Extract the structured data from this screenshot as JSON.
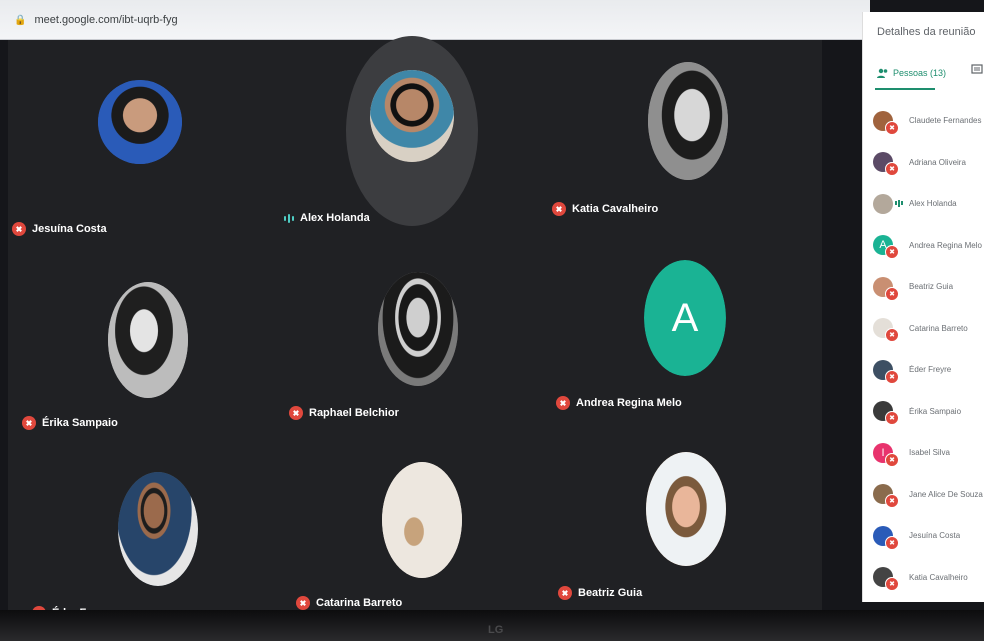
{
  "browser": {
    "url": "meet.google.com/ibt-uqrb-fyg"
  },
  "colors": {
    "mic_off": "#e0483d",
    "accent": "#1e8e6e",
    "stage_bg": "#202124",
    "andrea_avatar": "#1ab394",
    "isabel_avatar": "#e8336d"
  },
  "grid": {
    "tiles": [
      {
        "name": "Jesuína Costa",
        "state": "muted",
        "photo": "#2a5bb8"
      },
      {
        "name": "Alex Holanda",
        "state": "speaking",
        "photo": "#c9c0b4"
      },
      {
        "name": "Katia Cavalheiro",
        "state": "muted",
        "photo": "#9a9a9a"
      },
      {
        "name": "Érika Sampaio",
        "state": "muted",
        "photo": "#b9b9b9"
      },
      {
        "name": "Raphael Belchior",
        "state": "muted",
        "photo": "#6d6d6d"
      },
      {
        "name": "Andrea Regina Melo",
        "state": "muted",
        "letter": "A"
      },
      {
        "name": "Éder Freyre",
        "state": "muted",
        "photo": "#4a5f70"
      },
      {
        "name": "Catarina Barreto",
        "state": "muted",
        "photo": "#ede7df"
      },
      {
        "name": "Beatriz Guia",
        "state": "muted",
        "photo": "#d9b08c"
      }
    ]
  },
  "panel": {
    "title": "Detalhes da reunião",
    "people_tab": "Pessoas (13)",
    "people_icon": "people-icon",
    "chat_icon": "chat-icon",
    "people": [
      {
        "name": "Claudete Fernandes",
        "state": "muted"
      },
      {
        "name": "Adriana Oliveira",
        "state": "muted"
      },
      {
        "name": "Alex Holanda",
        "state": "speaking"
      },
      {
        "name": "Andrea Regina Melo",
        "state": "muted",
        "letter": "A"
      },
      {
        "name": "Beatriz Guia",
        "state": "muted"
      },
      {
        "name": "Catarina Barreto",
        "state": "muted"
      },
      {
        "name": "Éder Freyre",
        "state": "muted"
      },
      {
        "name": "Érika Sampaio",
        "state": "muted"
      },
      {
        "name": "Isabel Silva",
        "state": "muted",
        "letter": "I"
      },
      {
        "name": "Jane Alice De Souza T",
        "state": "muted"
      },
      {
        "name": "Jesuína Costa",
        "state": "muted"
      },
      {
        "name": "Katia Cavalheiro",
        "state": "muted"
      }
    ]
  },
  "monitor": {
    "brand": "LG"
  }
}
